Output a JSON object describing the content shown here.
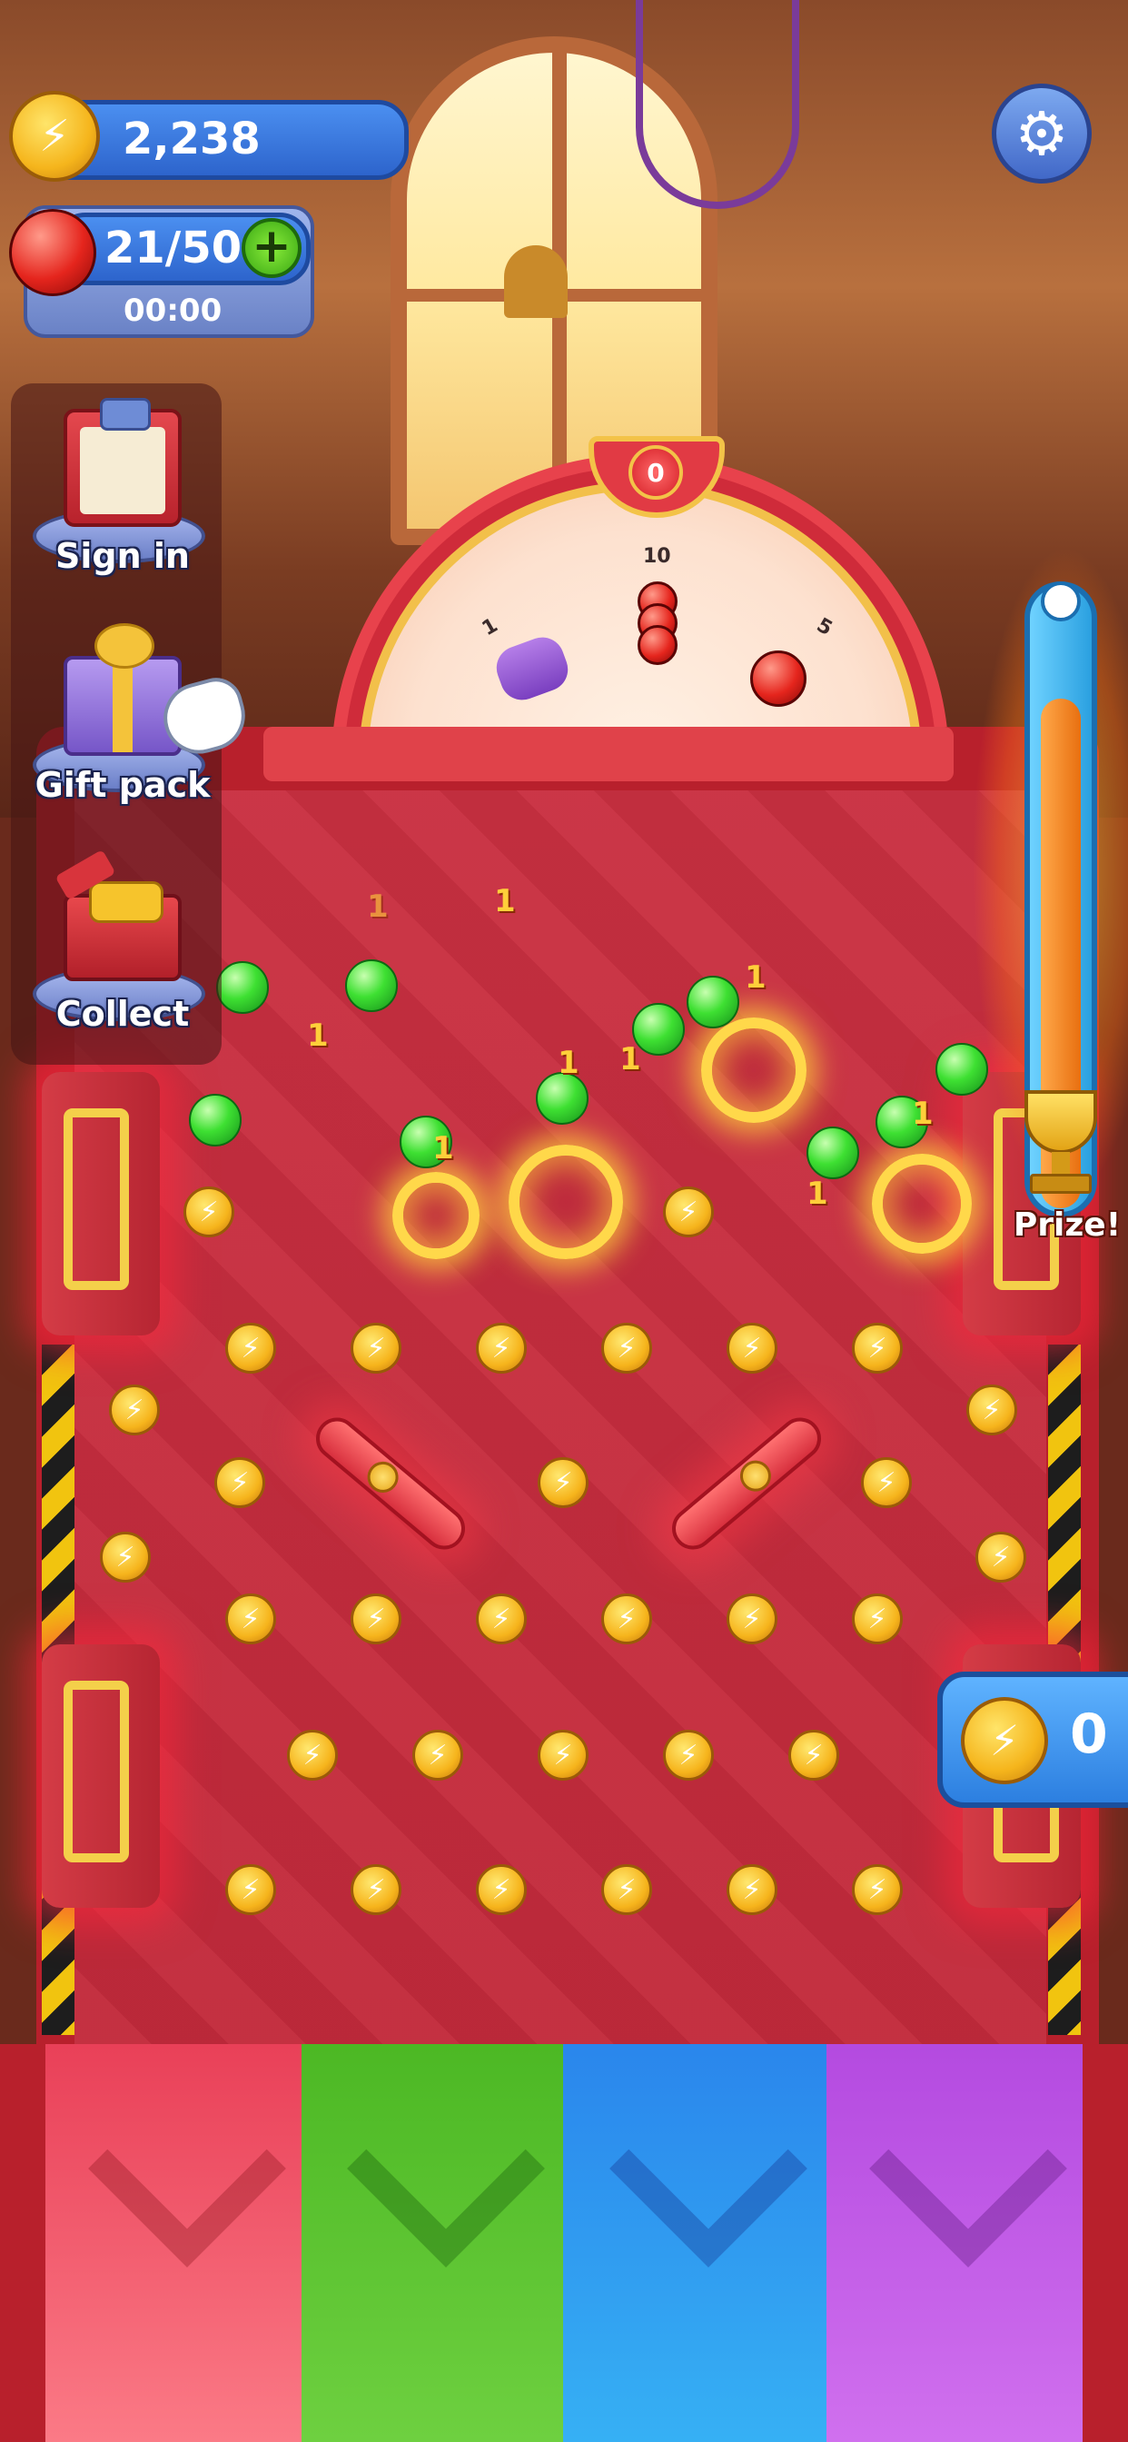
{
  "hud": {
    "coins": "2,238",
    "balls": "21/50",
    "timer": "00:00"
  },
  "side_menu": {
    "items": [
      {
        "label": "Sign in",
        "icon": "clipboard-icon"
      },
      {
        "label": "Gift pack",
        "icon": "gift-box-icon"
      },
      {
        "label": "Collect",
        "icon": "toy-box-icon"
      }
    ]
  },
  "wheel": {
    "pointer_value": "0",
    "segments": [
      {
        "label": "1",
        "icon": "gamepad-icon"
      },
      {
        "label": "10",
        "icon": "red-balls-icon"
      },
      {
        "label": "5",
        "icon": "crowned-ball-icon"
      }
    ]
  },
  "progress": {
    "label": "Prize!",
    "fill_fraction": 0.85
  },
  "pocket_counter": {
    "value": "0"
  },
  "float_numbers": [
    "1",
    "1",
    "1",
    "1",
    "1",
    "1",
    "1",
    "1",
    "1"
  ],
  "slots": {
    "colors": [
      "#f0566a",
      "#5dc632",
      "#2e94f0",
      "#c25ee6"
    ]
  },
  "colors": {
    "board": "#c22a3b",
    "hud_blue": "#2d64cc",
    "coin_gold": "#f5b51c",
    "ball_green": "#3ee032"
  }
}
